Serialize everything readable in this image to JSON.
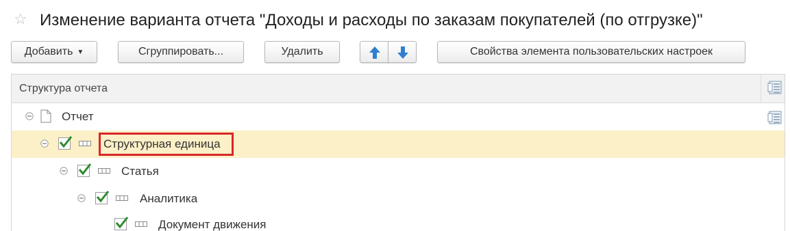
{
  "title": {
    "star_icon": "star-outline-icon",
    "text": "Изменение варианта отчета \"Доходы и расходы по заказам покупателей (по отгрузке)\""
  },
  "toolbar": {
    "add_label": "Добавить",
    "group_label": "Сгруппировать...",
    "delete_label": "Удалить",
    "move_up_icon": "arrow-up-icon",
    "move_down_icon": "arrow-down-icon",
    "properties_label": "Свойства элемента пользовательских настроек"
  },
  "tree": {
    "header_label": "Структура отчета",
    "rows": [
      {
        "label": "Отчет",
        "level": 0,
        "checked": null,
        "selected": false
      },
      {
        "label": "Структурная единица",
        "level": 1,
        "checked": true,
        "selected": true
      },
      {
        "label": "Статья",
        "level": 2,
        "checked": true,
        "selected": false
      },
      {
        "label": "Аналитика",
        "level": 3,
        "checked": true,
        "selected": false
      },
      {
        "label": "Документ движения",
        "level": 4,
        "checked": true,
        "selected": false
      }
    ]
  },
  "colors": {
    "selected_row": "#fbf0c7",
    "highlight_border": "#d9262a",
    "arrow_blue": "#2f7fd1",
    "check_green": "#2e8b2e"
  }
}
